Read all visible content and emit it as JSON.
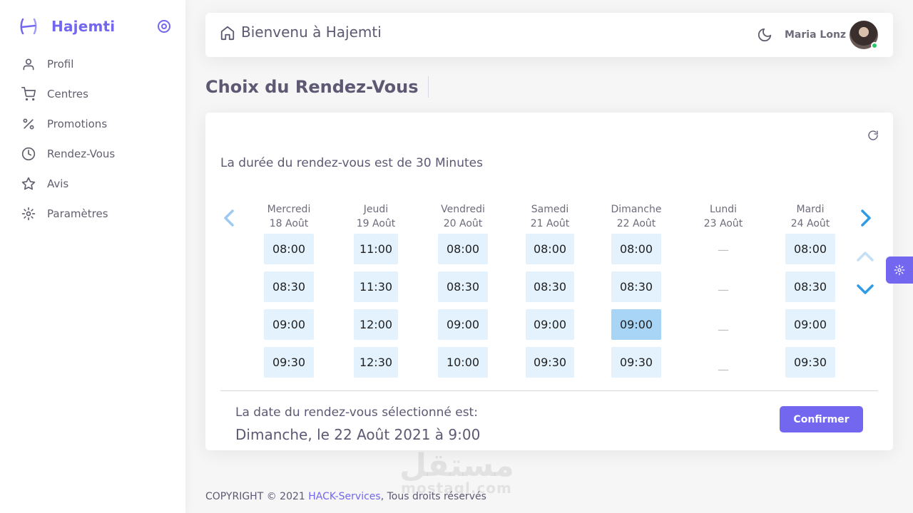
{
  "app": {
    "brand_name": "Hajemti",
    "accent_color": "#7367f0"
  },
  "sidebar": {
    "items": [
      {
        "label": "Profil",
        "icon": "user-icon"
      },
      {
        "label": "Centres",
        "icon": "cart-icon"
      },
      {
        "label": "Promotions",
        "icon": "percent-icon"
      },
      {
        "label": "Rendez-Vous",
        "icon": "clock-icon"
      },
      {
        "label": "Avis",
        "icon": "star-icon"
      },
      {
        "label": "Paramètres",
        "icon": "settings-icon"
      }
    ]
  },
  "header": {
    "title": "Bienvenu à Hajemti",
    "user_name": "Maria Lonz",
    "user_status": "online"
  },
  "page": {
    "title": "Choix du Rendez-Vous"
  },
  "booking": {
    "duration_text": "La durée du rendez-vous est de 30 Minutes",
    "days": [
      {
        "name": "Mercredi",
        "date": "18 Août",
        "slots": [
          "08:00",
          "08:30",
          "09:00",
          "09:30"
        ]
      },
      {
        "name": "Jeudi",
        "date": "19 Août",
        "slots": [
          "11:00",
          "11:30",
          "12:00",
          "12:30"
        ]
      },
      {
        "name": "Vendredi",
        "date": "20 Août",
        "slots": [
          "08:00",
          "08:30",
          "09:00",
          "10:00"
        ]
      },
      {
        "name": "Samedi",
        "date": "21 Août",
        "slots": [
          "08:00",
          "08:30",
          "09:00",
          "09:30"
        ]
      },
      {
        "name": "Dimanche",
        "date": "22 Août",
        "slots": [
          "08:00",
          "08:30",
          "09:00",
          "09:30"
        ]
      },
      {
        "name": "Lundi",
        "date": "23 Août",
        "slots": [
          "—",
          "—",
          "—",
          "—"
        ]
      },
      {
        "name": "Mardi",
        "date": "24 Août",
        "slots": [
          "08:00",
          "08:30",
          "09:00",
          "09:30"
        ]
      }
    ],
    "selected": {
      "day_index": 4,
      "slot_index": 2
    },
    "selected_label": "La date du rendez-vous sélectionné est:",
    "selected_value": "Dimanche, le 22 Août 2021 à 9:00",
    "confirm_label": "Confirmer"
  },
  "footer": {
    "copyright": "COPYRIGHT © 2021",
    "company": "HACK-Services",
    "rights": ", Tous droits réservés"
  },
  "watermark": {
    "text": "مستقل",
    "sub": "mostaql.com"
  }
}
